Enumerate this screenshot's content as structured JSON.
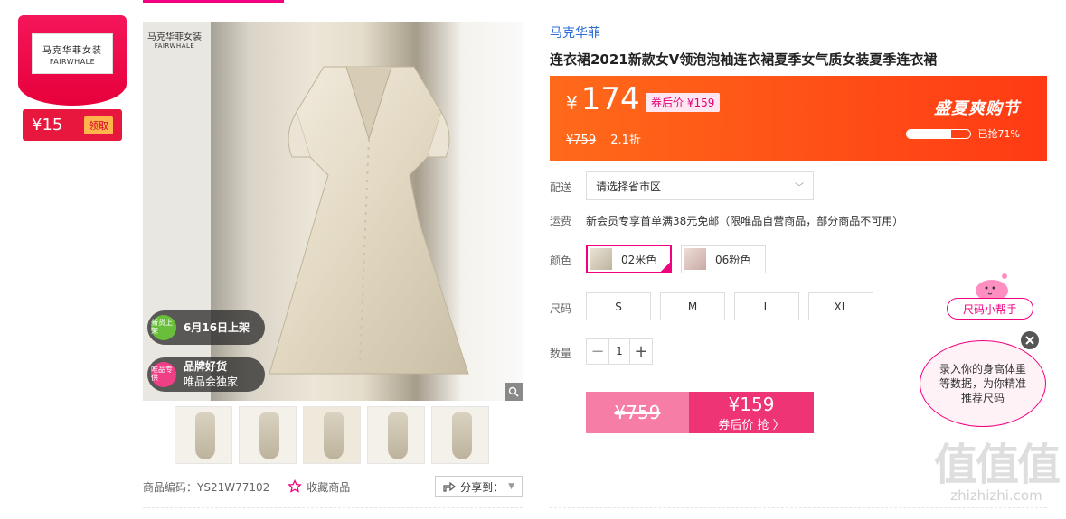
{
  "coupon": {
    "logo_cn": "马克华菲女装",
    "logo_en": "FAIRWHALE",
    "amount": "¥15",
    "button": "领取"
  },
  "gallery": {
    "watermark_cn": "马克华菲女装",
    "watermark_en": "FAIRWHALE",
    "badge_new_icon": "新货上架",
    "badge_new_text": "6月16日上架",
    "badge_brand_icon": "唯品专供",
    "badge_brand_title": "品牌好货",
    "badge_brand_sub": "唯品会独家",
    "thumbnail_count": 5
  },
  "meta": {
    "sku": "商品编码：YS21W77102",
    "favorite": "收藏商品",
    "share": "分享到："
  },
  "product": {
    "brand": "马克华菲",
    "title": "连衣裙2021新款女V领泡泡袖连衣裙夏季女气质女装夏季连衣裙"
  },
  "price": {
    "symbol": "¥",
    "current": "174",
    "after_coupon": "券后价 ¥159",
    "original": "¥759",
    "discount": "2.1折",
    "event": "盛夏爽购节",
    "sold_fraction": 0.71,
    "sold_text": "已抢71%"
  },
  "labels": {
    "delivery": "配送",
    "shipping": "运费",
    "color": "颜色",
    "size": "尺码",
    "quantity": "数量"
  },
  "delivery": {
    "placeholder": "请选择省市区"
  },
  "shipping": {
    "text": "新会员专享首单满38元免邮（限唯品自营商品，部分商品不可用）"
  },
  "colors": [
    {
      "label": "02米色",
      "selected": true
    },
    {
      "label": "06粉色",
      "selected": false
    }
  ],
  "sizes": [
    "S",
    "M",
    "L",
    "XL"
  ],
  "quantity": {
    "value": "1",
    "minus": "−",
    "plus": "+"
  },
  "buy": {
    "original": "¥759",
    "price": "¥159",
    "action": "券后价 抢 〉"
  },
  "size_helper": {
    "button": "尺码小帮手",
    "bubble": "录入你的身高体重等数据，为你精准推荐尺码"
  },
  "watermark": {
    "big": "值值值",
    "small": "zhizhizhi.com"
  },
  "colors_theme": {
    "accent": "#f10180",
    "price_bg": "#ff4a14",
    "buy_main": "#ee3474",
    "buy_light": "#f67ea6"
  }
}
